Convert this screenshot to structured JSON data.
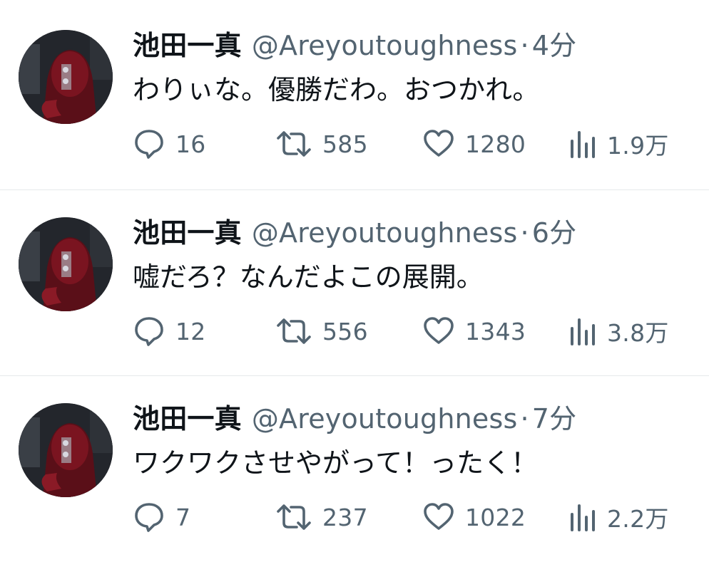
{
  "colors": {
    "text_primary": "#0f1419",
    "text_secondary": "#536471",
    "divider": "#e6e9eb",
    "background": "#ffffff"
  },
  "icons": {
    "reply": "speech-bubble-icon",
    "retweet": "retweet-arrows-icon",
    "like": "heart-icon",
    "views": "bar-chart-icon"
  },
  "tweets": [
    {
      "display_name": "池田一真",
      "handle": "@Areyoutoughness",
      "separator": "·",
      "time": "4分",
      "text": "わりぃな。優勝だわ。おつかれ。",
      "replies": "16",
      "retweets": "585",
      "likes": "1280",
      "views": "1.9万"
    },
    {
      "display_name": "池田一真",
      "handle": "@Areyoutoughness",
      "separator": "·",
      "time": "6分",
      "text": "嘘だろ？なんだよこの展開。",
      "replies": "12",
      "retweets": "556",
      "likes": "1343",
      "views": "3.8万"
    },
    {
      "display_name": "池田一真",
      "handle": "@Areyoutoughness",
      "separator": "·",
      "time": "7分",
      "text": "ワクワクさせやがって！ったく！",
      "replies": "7",
      "retweets": "237",
      "likes": "1022",
      "views": "2.2万"
    }
  ]
}
